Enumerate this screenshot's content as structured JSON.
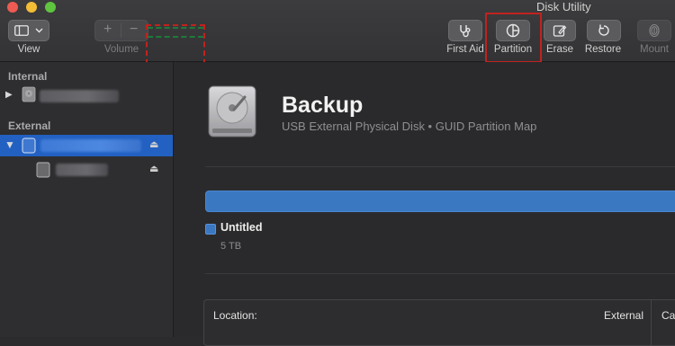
{
  "window": {
    "title": "Disk Utility"
  },
  "toolbar": {
    "view_label": "View",
    "volume_label": "Volume",
    "first_aid_label": "First Aid",
    "partition_label": "Partition",
    "erase_label": "Erase",
    "restore_label": "Restore",
    "mount_label": "Mount",
    "plus_glyph": "+",
    "minus_glyph": "−"
  },
  "sidebar": {
    "internal_header": "Internal",
    "external_header": "External",
    "eject_glyph": "⏏"
  },
  "disk": {
    "name": "Backup",
    "subtitle": "USB External Physical Disk • GUID Partition Map"
  },
  "partition_map": {
    "volumes": [
      {
        "name": "Untitled",
        "size": "5 TB",
        "color": "#3b78c2"
      }
    ]
  },
  "info": {
    "location_key": "Location:",
    "location_value": "External",
    "next_key_partial": "Ca"
  },
  "colors": {
    "selection": "#2261c2",
    "highlight_annotation": "#c0221f",
    "green_annotation": "#1f7a3a"
  }
}
